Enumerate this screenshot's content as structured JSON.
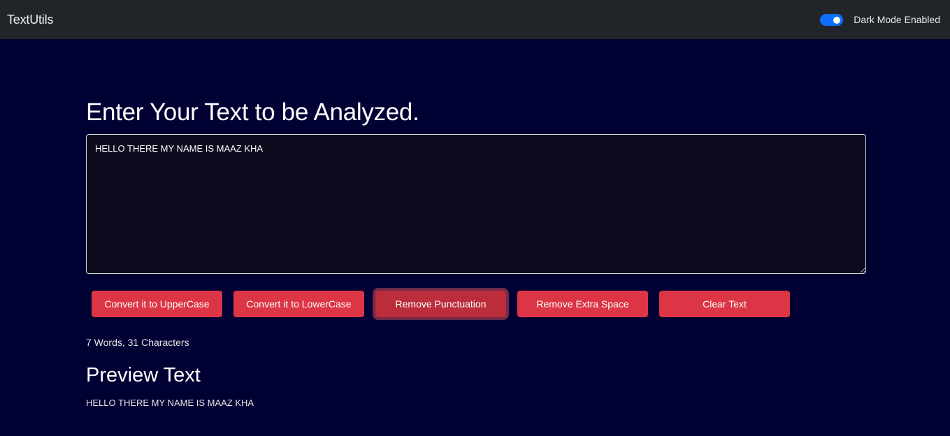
{
  "navbar": {
    "brand": "TextUtils",
    "dark_mode_label": "Dark Mode Enabled",
    "dark_mode_enabled": true
  },
  "main": {
    "heading": "Enter Your Text to be Analyzed.",
    "textarea_value": "HELLO THERE MY NAME IS MAAZ KHA",
    "buttons": {
      "uppercase": "Convert it to UpperCase",
      "lowercase": "Convert it to LowerCase",
      "remove_punctuation": "Remove Punctuation",
      "remove_extra_space": "Remove Extra Space",
      "clear": "Clear Text"
    },
    "summary": "7 Words, 31 Characters",
    "preview_heading": "Preview Text",
    "preview_text": "HELLO THERE MY NAME IS MAAZ KHA"
  },
  "colors": {
    "background": "#000033",
    "navbar": "#212529",
    "button": "#dc3545",
    "toggle": "#0d6efd"
  }
}
